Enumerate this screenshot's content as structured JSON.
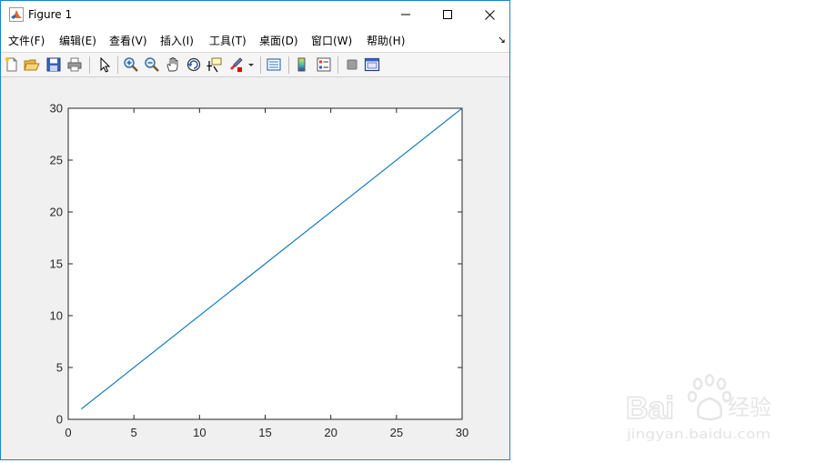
{
  "window": {
    "title": "Figure 1"
  },
  "menu": {
    "items": [
      {
        "label": "文件(F)",
        "name": "menu-file"
      },
      {
        "label": "编辑(E)",
        "name": "menu-edit"
      },
      {
        "label": "查看(V)",
        "name": "menu-view"
      },
      {
        "label": "插入(I)",
        "name": "menu-insert"
      },
      {
        "label": "工具(T)",
        "name": "menu-tools"
      },
      {
        "label": "桌面(D)",
        "name": "menu-desktop"
      },
      {
        "label": "窗口(W)",
        "name": "menu-window"
      },
      {
        "label": "帮助(H)",
        "name": "menu-help"
      }
    ],
    "overflow_glyph": "↘"
  },
  "toolbar": {
    "icons": [
      "new-figure-icon",
      "open-file-icon",
      "save-icon",
      "print-icon",
      "edit-plot-cursor-icon",
      "zoom-in-icon",
      "zoom-out-icon",
      "pan-hand-icon",
      "rotate-3d-icon",
      "data-cursor-icon",
      "brush-icon",
      "link-plot-icon",
      "colorbar-icon",
      "legend-icon",
      "hide-plot-tools-icon",
      "show-plot-tools-icon"
    ]
  },
  "chart_data": {
    "type": "line",
    "x": [
      1,
      30
    ],
    "y": [
      1,
      30
    ],
    "xlim": [
      0,
      30
    ],
    "ylim": [
      0,
      30
    ],
    "xticks": [
      0,
      5,
      10,
      15,
      20,
      25,
      30
    ],
    "yticks": [
      0,
      5,
      10,
      15,
      20,
      25,
      30
    ],
    "series_color": "#0072bd",
    "grid": false,
    "title": "",
    "xlabel": "",
    "ylabel": ""
  },
  "watermark": {
    "brand_text": "Bai",
    "brand_suffix": "经验",
    "url": "jingyan.baidu.com"
  }
}
